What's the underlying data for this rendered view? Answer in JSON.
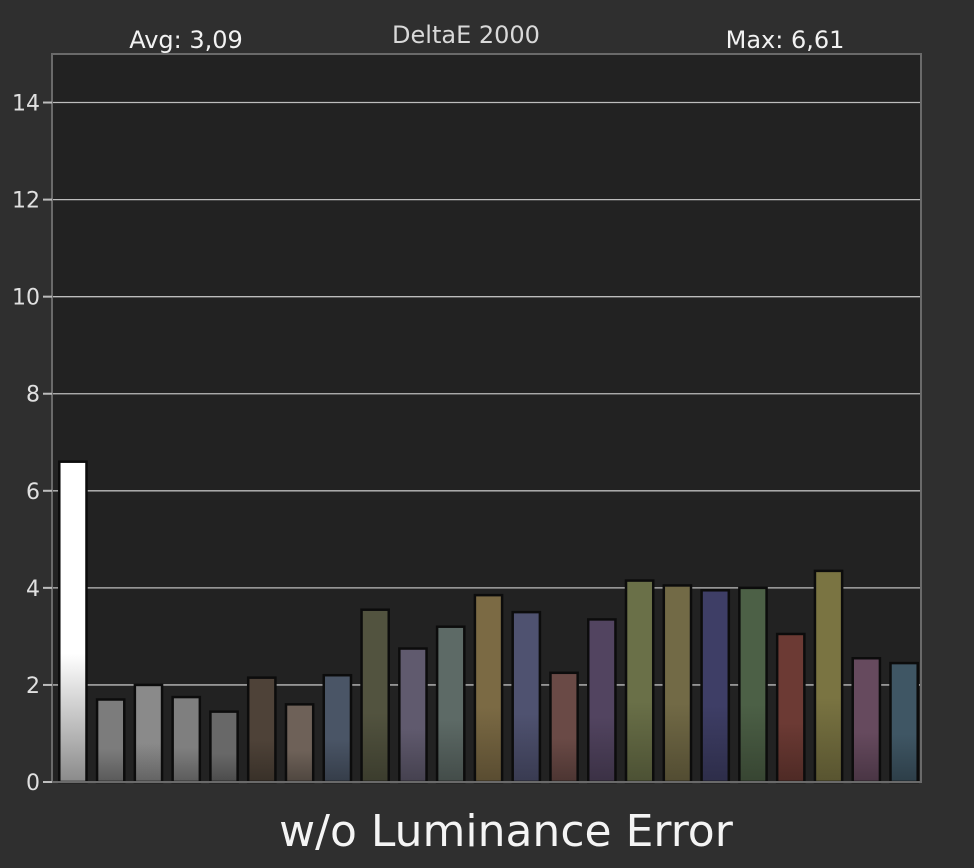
{
  "chart_data": {
    "type": "bar",
    "title": "DeltaE 2000",
    "avg_label": "Avg: 3,09",
    "max_label": "Max: 6,61",
    "footer": "w/o Luminance Error",
    "ylim": [
      0,
      15
    ],
    "yticks": [
      0,
      2,
      4,
      6,
      8,
      10,
      12,
      14
    ],
    "grid": true,
    "values": [
      6.6,
      1.7,
      2.0,
      1.75,
      1.45,
      2.15,
      1.6,
      2.2,
      3.55,
      2.75,
      3.2,
      3.85,
      3.5,
      2.25,
      3.35,
      4.15,
      4.05,
      3.95,
      4.0,
      3.05,
      4.35,
      2.55,
      2.45
    ],
    "colors": [
      "#ffffff",
      "#7c7c7c",
      "#8a8a8a",
      "#7f7f7f",
      "#686868",
      "#4e4238",
      "#6e6158",
      "#4a5566",
      "#52533f",
      "#605a6e",
      "#5d6a66",
      "#7b6a44",
      "#4f5270",
      "#6a4a46",
      "#524460",
      "#6a7048",
      "#726a46",
      "#3e3e66",
      "#4c6046",
      "#6c3a34",
      "#7a7442",
      "#664a5e",
      "#3f5664"
    ]
  }
}
